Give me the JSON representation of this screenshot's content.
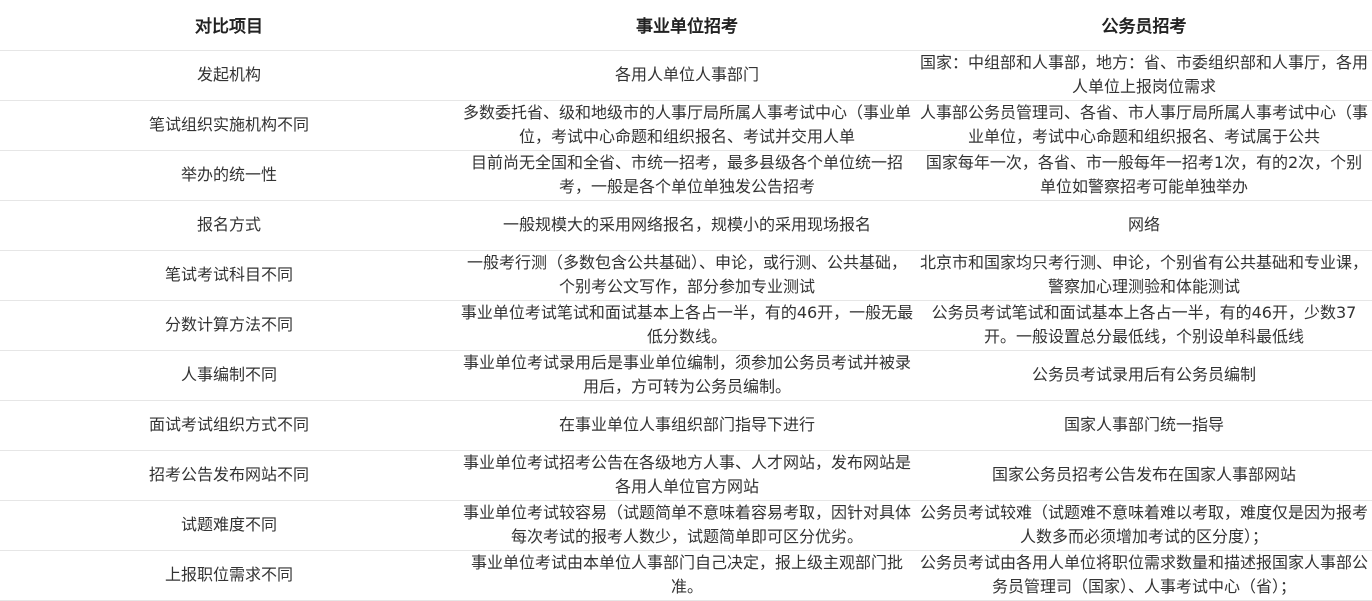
{
  "headers": [
    "对比项目",
    "事业单位招考",
    "公务员招考"
  ],
  "rows": [
    {
      "item": "发起机构",
      "shiye": "各用人单位人事部门",
      "gongwuyuan": "国家：中组部和人事部，地方：省、市委组织部和人事厅，各用人单位上报岗位需求"
    },
    {
      "item": "笔试组织实施机构不同",
      "shiye": "多数委托省、级和地级市的人事厅局所属人事考试中心（事业单位，考试中心命题和组织报名、考试并交用人单",
      "gongwuyuan": "人事部公务员管理司、各省、市人事厅局所属人事考试中心（事业单位，考试中心命题和组织报名、考试属于公共"
    },
    {
      "item": "举办的统一性",
      "shiye": "目前尚无全国和全省、市统一招考，最多县级各个单位统一招考，一般是各个单位单独发公告招考",
      "gongwuyuan": "国家每年一次，各省、市一般每年一招考1次，有的2次，个别单位如警察招考可能单独举办"
    },
    {
      "item": "报名方式",
      "shiye": "一般规模大的采用网络报名，规模小的采用现场报名",
      "gongwuyuan": "网络"
    },
    {
      "item": "笔试考试科目不同",
      "shiye": "一般考行测（多数包含公共基础）、申论，或行测、公共基础，个别考公文写作，部分参加专业测试",
      "gongwuyuan": "北京市和国家均只考行测、申论，个别省有公共基础和专业课，警察加心理测验和体能测试"
    },
    {
      "item": "分数计算方法不同",
      "shiye": "事业单位考试笔试和面试基本上各占一半，有的46开，一般无最低分数线。",
      "gongwuyuan": "公务员考试笔试和面试基本上各占一半，有的46开，少数37开。一般设置总分最低线，个别设单科最低线"
    },
    {
      "item": "人事编制不同",
      "shiye": "事业单位考试录用后是事业单位编制，须参加公务员考试并被录用后，方可转为公务员编制。",
      "gongwuyuan": "公务员考试录用后有公务员编制"
    },
    {
      "item": "面试考试组织方式不同",
      "shiye": "在事业单位人事组织部门指导下进行",
      "gongwuyuan": "国家人事部门统一指导"
    },
    {
      "item": "招考公告发布网站不同",
      "shiye": "事业单位考试招考公告在各级地方人事、人才网站，发布网站是各用人单位官方网站",
      "gongwuyuan": "国家公务员招考公告发布在国家人事部网站"
    },
    {
      "item": "试题难度不同",
      "shiye": "事业单位考试较容易（试题简单不意味着容易考取，因针对具体每次考试的报考人数少，试题简单即可区分优劣。",
      "gongwuyuan": "公务员考试较难（试题难不意味着难以考取，难度仅是因为报考人数多而必须增加考试的区分度）；"
    },
    {
      "item": "上报职位需求不同",
      "shiye": "事业单位考试由本单位人事部门自己决定，报上级主观部门批准。",
      "gongwuyuan": "公务员考试由各用人单位将职位需求数量和描述报国家人事部公务员管理司（国家）、人事考试中心（省）；"
    }
  ]
}
